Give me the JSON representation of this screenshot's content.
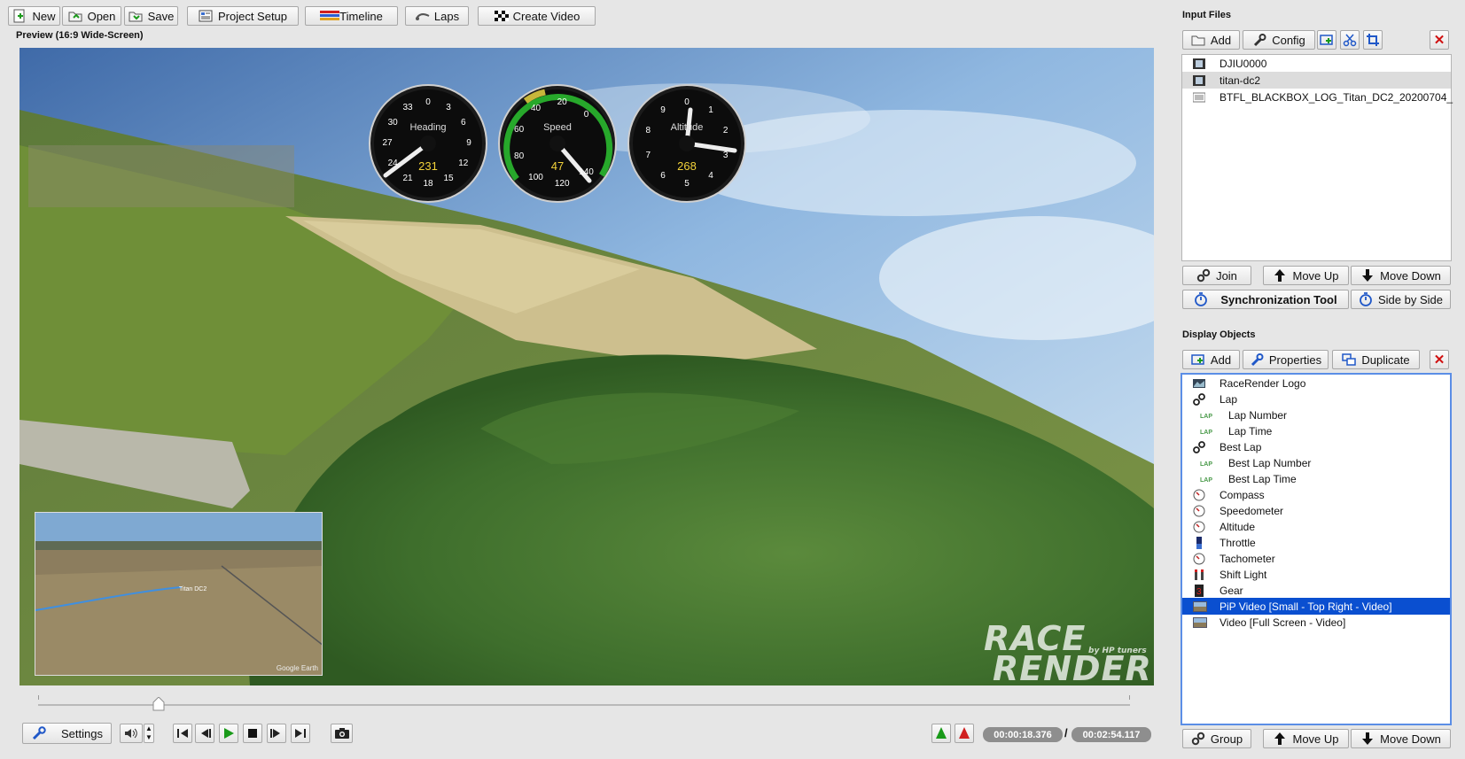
{
  "toolbar": {
    "new_label": "New",
    "open_label": "Open",
    "save_label": "Save",
    "project_setup_label": "Project Setup",
    "timeline_label": "Timeline",
    "laps_label": "Laps",
    "create_video_label": "Create Video"
  },
  "preview": {
    "title": "Preview (16:9 Wide-Screen)",
    "watermark_line1": "RACE",
    "watermark_line2": "RENDER",
    "watermark_by": "by HP tuners",
    "pip_label": "Titan DC2",
    "pip_credit": "Google Earth",
    "gauges": {
      "heading": {
        "title": "Heading",
        "value": "231",
        "ticks": [
          "0",
          "3",
          "6",
          "9",
          "12",
          "15",
          "18",
          "21",
          "24",
          "27",
          "30",
          "33"
        ]
      },
      "speed": {
        "title": "Speed",
        "value": "47",
        "ticks": [
          "0",
          "20",
          "40",
          "60",
          "80",
          "100",
          "120",
          "140"
        ]
      },
      "altitude": {
        "title": "Altitude",
        "value": "268",
        "ticks": [
          "0",
          "1",
          "2",
          "3",
          "4",
          "5",
          "6",
          "7",
          "8",
          "9"
        ]
      }
    }
  },
  "controls": {
    "settings_label": "Settings",
    "current_time": "00:00:18.376",
    "separator": "/",
    "total_time": "00:02:54.117",
    "progress": 0.11
  },
  "input_files": {
    "title": "Input Files",
    "add_label": "Add",
    "config_label": "Config",
    "files": [
      {
        "name": "DJIU0000",
        "icon": "video-file-icon",
        "selected": false
      },
      {
        "name": "titan-dc2",
        "icon": "video-file-icon",
        "selected": true
      },
      {
        "name": "BTFL_BLACKBOX_LOG_Titan_DC2_20200704_",
        "icon": "data-file-icon",
        "selected": false
      }
    ],
    "join_label": "Join",
    "move_up_label": "Move Up",
    "move_down_label": "Move Down",
    "sync_tool_label": "Synchronization Tool",
    "side_by_side_label": "Side by Side"
  },
  "display_objects": {
    "title": "Display Objects",
    "add_label": "Add",
    "properties_label": "Properties",
    "duplicate_label": "Duplicate",
    "items": [
      {
        "label": "RaceRender Logo",
        "icon": "logo-icon",
        "indent": false,
        "selected": false
      },
      {
        "label": "Lap",
        "icon": "link-icon",
        "indent": false,
        "selected": false
      },
      {
        "label": "Lap Number",
        "icon": "lap-icon",
        "indent": true,
        "selected": false
      },
      {
        "label": "Lap Time",
        "icon": "lap-icon",
        "indent": true,
        "selected": false
      },
      {
        "label": "Best Lap",
        "icon": "link-icon",
        "indent": false,
        "selected": false
      },
      {
        "label": "Best Lap Number",
        "icon": "lap-icon",
        "indent": true,
        "selected": false
      },
      {
        "label": "Best Lap Time",
        "icon": "lap-icon",
        "indent": true,
        "selected": false
      },
      {
        "label": "Compass",
        "icon": "gauge-icon",
        "indent": false,
        "selected": false
      },
      {
        "label": "Speedometer",
        "icon": "gauge-icon",
        "indent": false,
        "selected": false
      },
      {
        "label": "Altitude",
        "icon": "gauge-icon",
        "indent": false,
        "selected": false
      },
      {
        "label": "Throttle",
        "icon": "bar-icon",
        "indent": false,
        "selected": false
      },
      {
        "label": "Tachometer",
        "icon": "gauge-icon",
        "indent": false,
        "selected": false
      },
      {
        "label": "Shift Light",
        "icon": "shift-light-icon",
        "indent": false,
        "selected": false
      },
      {
        "label": "Gear",
        "icon": "gear-digit-icon",
        "indent": false,
        "selected": false
      },
      {
        "label": "PiP Video [Small - Top Right - Video]",
        "icon": "video-object-icon",
        "indent": false,
        "selected": true
      },
      {
        "label": "Video [Full Screen - Video]",
        "icon": "video-object-icon",
        "indent": false,
        "selected": false
      }
    ],
    "group_label": "Group",
    "move_up_label": "Move Up",
    "move_down_label": "Move Down"
  },
  "colors": {
    "selection": "#0a4fd0",
    "close_red": "#d01010",
    "play_green": "#1a9a1a",
    "gauge_yellow": "#f2d23a",
    "speed_band_green": "#27a82b"
  }
}
